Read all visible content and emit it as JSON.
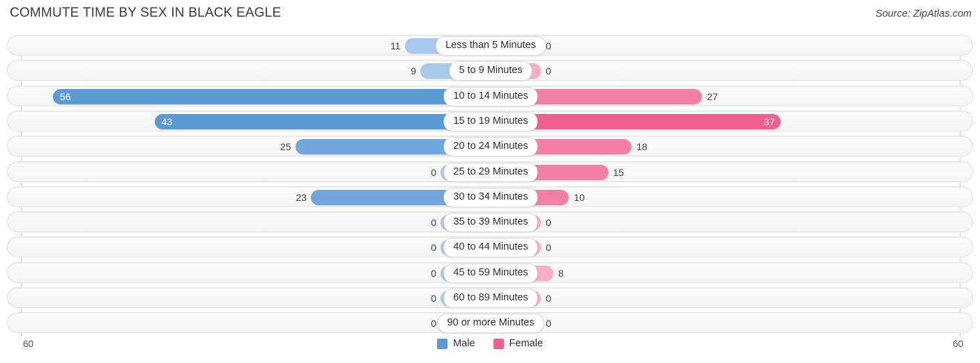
{
  "header": {
    "title": "COMMUTE TIME BY SEX IN BLACK EAGLE",
    "source": "Source: ZipAtlas.com"
  },
  "legend": {
    "male_label": "Male",
    "female_label": "Female",
    "male_color": "#5b9bd5",
    "female_color": "#ef5f90"
  },
  "axis": {
    "left_max_label": "60",
    "right_max_label": "60"
  },
  "colors": {
    "male_light": "#a9c9ec",
    "male_dark": "#6fa6dd",
    "male_darker": "#5b9bd5",
    "female_light": "#f9aec8",
    "female_mid": "#f47fa6",
    "female_dark": "#ef5f90",
    "track": "#f6f6f6",
    "track_border": "#e3e3e3"
  },
  "chart_data": {
    "type": "bar",
    "title": "COMMUTE TIME BY SEX IN BLACK EAGLE",
    "subtitle": "Source: ZipAtlas.com",
    "xlabel": "",
    "ylabel": "",
    "orientation": "horizontal-diverging",
    "xlim": [
      0,
      60
    ],
    "grid": false,
    "legend_position": "bottom-center",
    "categories": [
      "Less than 5 Minutes",
      "5 to 9 Minutes",
      "10 to 14 Minutes",
      "15 to 19 Minutes",
      "20 to 24 Minutes",
      "25 to 29 Minutes",
      "30 to 34 Minutes",
      "35 to 39 Minutes",
      "40 to 44 Minutes",
      "45 to 59 Minutes",
      "60 to 89 Minutes",
      "90 or more Minutes"
    ],
    "series": [
      {
        "name": "Male",
        "values": [
          11,
          9,
          56,
          43,
          25,
          0,
          23,
          0,
          0,
          0,
          0,
          0
        ]
      },
      {
        "name": "Female",
        "values": [
          0,
          0,
          27,
          37,
          18,
          15,
          10,
          0,
          0,
          8,
          0,
          0
        ]
      }
    ]
  },
  "rows": [
    {
      "label": "Less than 5 Minutes",
      "male": 11,
      "female": 0,
      "male_text": "11",
      "female_text": "0"
    },
    {
      "label": "5 to 9 Minutes",
      "male": 9,
      "female": 0,
      "male_text": "9",
      "female_text": "0"
    },
    {
      "label": "10 to 14 Minutes",
      "male": 56,
      "female": 27,
      "male_text": "56",
      "female_text": "27"
    },
    {
      "label": "15 to 19 Minutes",
      "male": 43,
      "female": 37,
      "male_text": "43",
      "female_text": "37"
    },
    {
      "label": "20 to 24 Minutes",
      "male": 25,
      "female": 18,
      "male_text": "25",
      "female_text": "18"
    },
    {
      "label": "25 to 29 Minutes",
      "male": 0,
      "female": 15,
      "male_text": "0",
      "female_text": "15"
    },
    {
      "label": "30 to 34 Minutes",
      "male": 23,
      "female": 10,
      "male_text": "23",
      "female_text": "10"
    },
    {
      "label": "35 to 39 Minutes",
      "male": 0,
      "female": 0,
      "male_text": "0",
      "female_text": "0"
    },
    {
      "label": "40 to 44 Minutes",
      "male": 0,
      "female": 0,
      "male_text": "0",
      "female_text": "0"
    },
    {
      "label": "45 to 59 Minutes",
      "male": 0,
      "female": 8,
      "male_text": "0",
      "female_text": "8"
    },
    {
      "label": "60 to 89 Minutes",
      "male": 0,
      "female": 0,
      "male_text": "0",
      "female_text": "0"
    },
    {
      "label": "90 or more Minutes",
      "male": 0,
      "female": 0,
      "male_text": "0",
      "female_text": "0"
    }
  ]
}
